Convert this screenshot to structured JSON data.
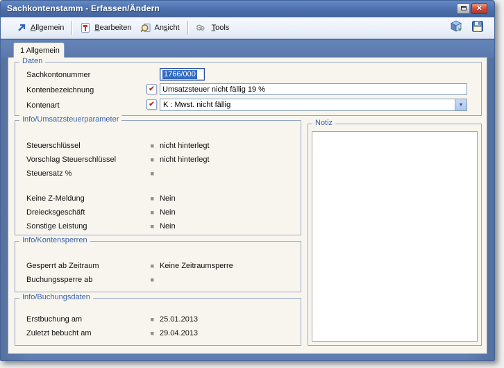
{
  "window": {
    "title": "Sachkontenstamm - Erfassen/Ändern"
  },
  "glyphs": {
    "close": "✕",
    "dropdown": "▼",
    "check": "✔",
    "gear": "⚙"
  },
  "toolbar": {
    "allgemein": {
      "pre": "",
      "u": "A",
      "rest": "llgemein",
      "icon": "jump-arrow-icon"
    },
    "bearbeiten": {
      "pre": "",
      "u": "B",
      "rest": "earbeiten",
      "icon": "edit-tool-icon"
    },
    "ansicht": {
      "pre": "An",
      "u": "s",
      "rest": "icht",
      "icon": "view-magnifier-icon"
    },
    "tools": {
      "pre": "",
      "u": "T",
      "rest": "ools",
      "icon": "tools-gears-icon"
    },
    "right_icons": [
      "export-box-icon",
      "save-disk-icon"
    ]
  },
  "tab": {
    "label": "1 Allgemein"
  },
  "groups": {
    "daten": {
      "title": "Daten",
      "fields": {
        "kontonummer": {
          "label": "Sachkontonummer",
          "value": "1766/000"
        },
        "bezeichnung": {
          "label": "Kontenbezeichnung",
          "value": "Umsatzsteuer nicht fällig 19 %"
        },
        "kontenart": {
          "label": "Kontenart",
          "value": "K : Mwst. nicht fällig"
        }
      }
    },
    "ust": {
      "title": "Info/Umsatzsteuerparameter",
      "rows": [
        {
          "label": "Steuerschlüssel",
          "value": "nicht hinterlegt"
        },
        {
          "label": "Vorschlag Steuerschlüssel",
          "value": "nicht hinterlegt"
        },
        {
          "label": "Steuersatz %",
          "value": ""
        },
        {
          "label": "Keine Z-Meldung",
          "value": "Nein"
        },
        {
          "label": "Dreiecksgeschäft",
          "value": "Nein"
        },
        {
          "label": "Sonstige Leistung",
          "value": "Nein"
        }
      ]
    },
    "kontensperren": {
      "title": "Info/Kontensperren",
      "rows": [
        {
          "label": "Gesperrt ab Zeitraum",
          "value": "Keine Zeitraumsperre"
        },
        {
          "label": "Buchungssperre ab",
          "value": ""
        }
      ]
    },
    "buchungsdaten": {
      "title": "Info/Buchungsdaten",
      "rows": [
        {
          "label": "Erstbuchung am",
          "value": "25.01.2013"
        },
        {
          "label": "Zuletzt bebucht am",
          "value": "29.04.2013"
        }
      ]
    },
    "notiz": {
      "title": "Notiz",
      "value": ""
    }
  }
}
